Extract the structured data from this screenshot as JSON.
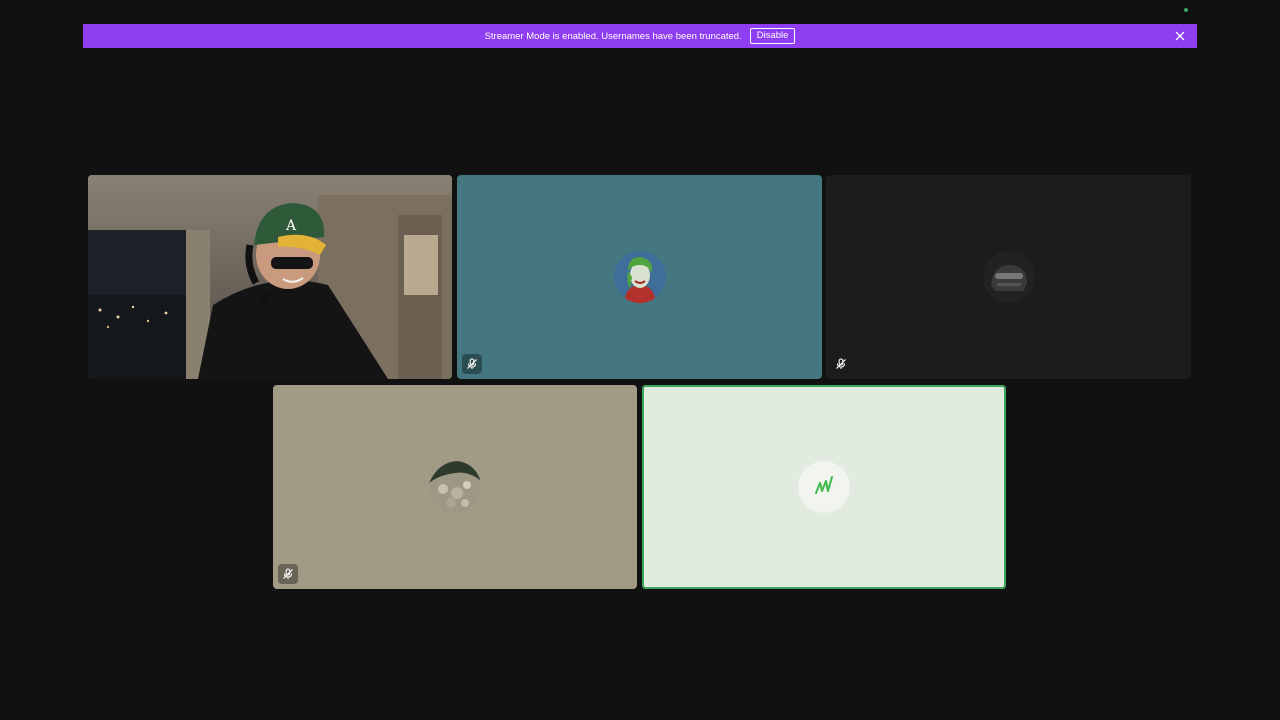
{
  "banner": {
    "message": "Streamer Mode is enabled. Usernames have been truncated.",
    "disable_label": "Disable",
    "color": "#8f3df0"
  },
  "tiles": [
    {
      "kind": "video",
      "speaking": true,
      "muted": false,
      "background": "#4a4640"
    },
    {
      "kind": "avatar",
      "speaking": false,
      "muted": true,
      "background": "#44777f",
      "avatar": "green-haired-joker-avatar"
    },
    {
      "kind": "avatar",
      "speaking": false,
      "muted": true,
      "background": "#1c1c1d",
      "avatar": "dark-helmet-avatar"
    },
    {
      "kind": "avatar",
      "speaking": false,
      "muted": true,
      "background": "#a19a85",
      "avatar": "rock-texture-avatar"
    },
    {
      "kind": "avatar",
      "speaking": true,
      "muted": false,
      "background": "#e1ebe0",
      "avatar": "green-logo-avatar"
    }
  ],
  "colors": {
    "speaking_ring": "#3ba55d",
    "app_background": "#111112",
    "online_dot": "#3ba55d"
  }
}
